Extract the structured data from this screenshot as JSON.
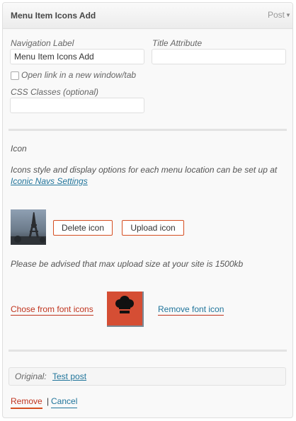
{
  "header": {
    "title": "Menu Item Icons Add",
    "type": "Post",
    "toggle": "▼"
  },
  "fields": {
    "nav_label": {
      "label": "Navigation Label",
      "value": "Menu Item Icons Add"
    },
    "title_attr": {
      "label": "Title Attribute",
      "value": ""
    },
    "open_new_window": {
      "label": "Open link in a new window/tab",
      "checked": false
    },
    "css_classes": {
      "label": "CSS Classes (optional)",
      "value": ""
    }
  },
  "icon_section": {
    "heading": "Icon",
    "description": "Icons style and display options for each menu location can be set up at",
    "settings_link": "Iconic Navs Settings",
    "delete_button": "Delete icon",
    "upload_button": "Upload icon",
    "upload_notice": "Please be advised that max upload size at your site is 1500kb",
    "choose_font_link": "Chose from font icons",
    "remove_font_link": "Remove font icon",
    "font_icon_name": "chef-hat-icon",
    "accent_color": "#d54e34"
  },
  "original": {
    "label": "Original:",
    "link": "Test post"
  },
  "actions": {
    "remove": "Remove",
    "separator": "|",
    "cancel": "Cancel"
  }
}
